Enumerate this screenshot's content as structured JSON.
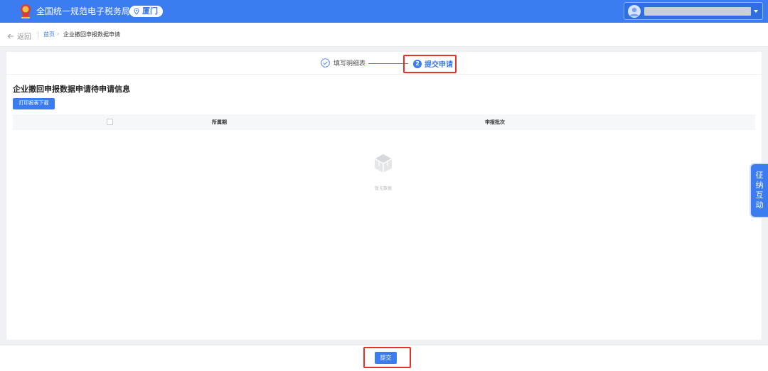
{
  "header": {
    "site_title": "全国统一规范电子税务局",
    "city": "厦门",
    "brand_color": "#3b7cf0"
  },
  "breadcrumb": {
    "back_label": "返回",
    "home": "首页",
    "separator": "›",
    "current": "企业撤回申报数据申请"
  },
  "steps": [
    {
      "label": "填写明细表",
      "status": "done",
      "icon": "check-circle-icon"
    },
    {
      "number": "2",
      "label": "提交申请",
      "status": "active"
    }
  ],
  "main": {
    "section_title": "企业撤回申报数据申请待申请信息",
    "print_button": "打印报表下载",
    "table": {
      "columns": [
        "所属期",
        "申报批次"
      ],
      "rows": [],
      "empty_text": "暂无数据"
    }
  },
  "float_tab": {
    "chars": [
      "征",
      "纳",
      "互",
      "动"
    ]
  },
  "footer": {
    "submit_button": "提交"
  },
  "highlight_color": "#e8302b"
}
